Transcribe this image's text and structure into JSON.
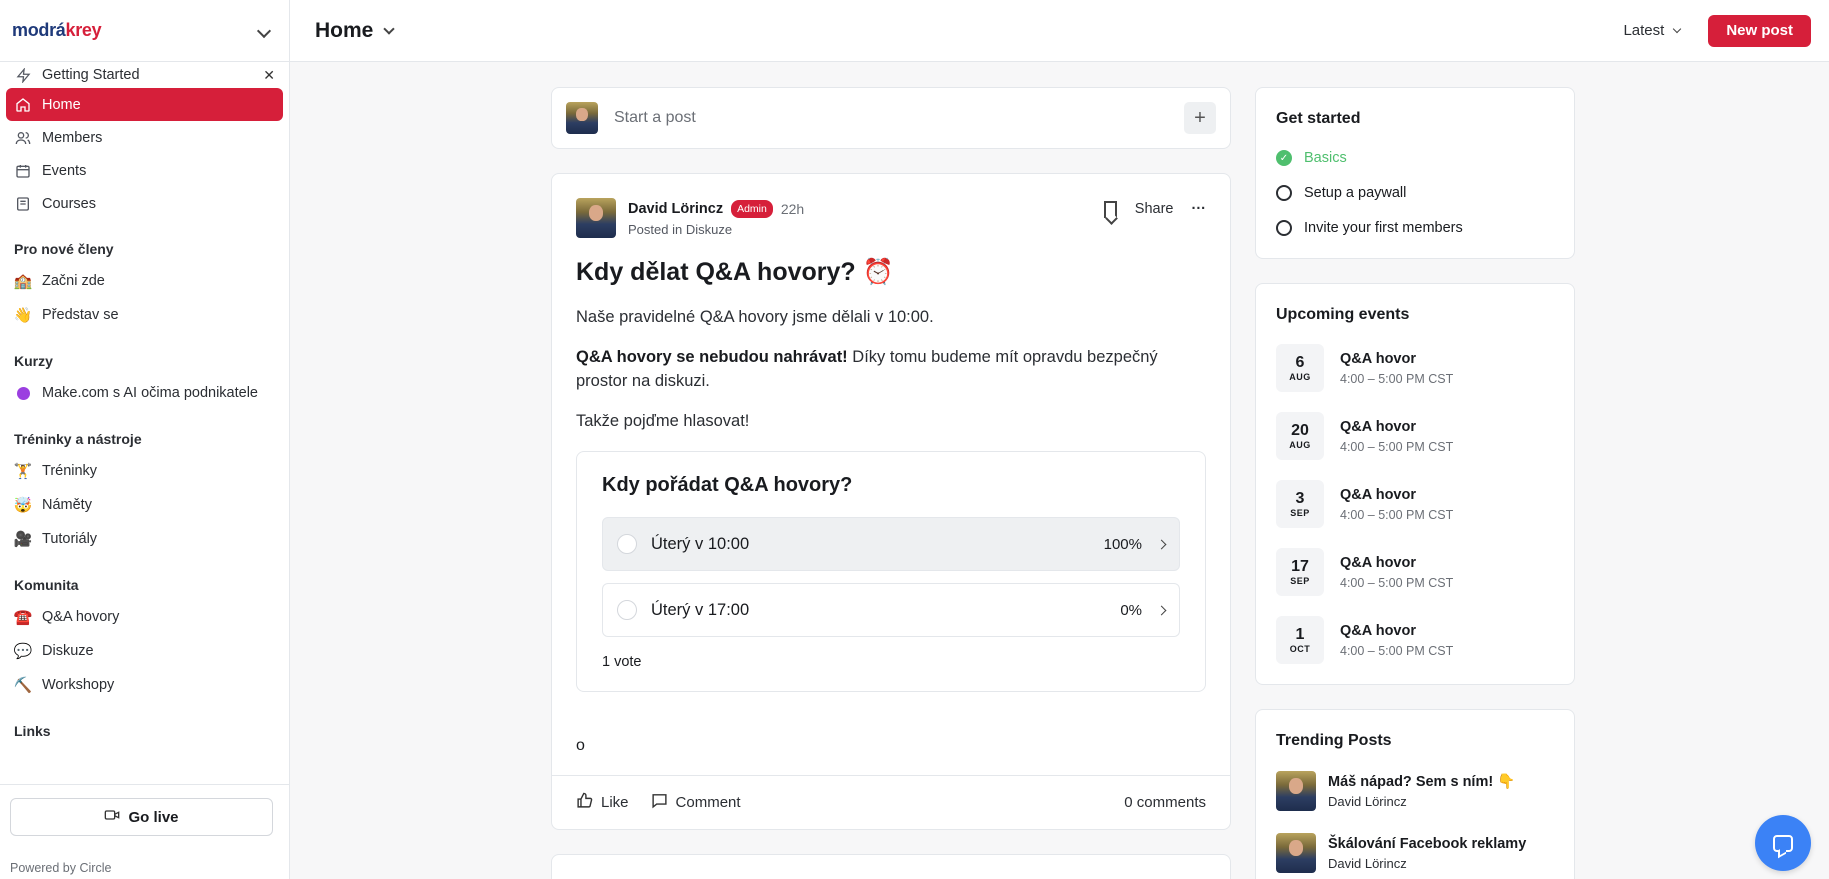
{
  "sidebar": {
    "logo_part1": "modrá",
    "logo_part2": "krey",
    "getting_started": "Getting Started",
    "close_symbol": "✕",
    "nav": [
      {
        "label": "Home",
        "icon": "home-icon"
      },
      {
        "label": "Members",
        "icon": "members-icon"
      },
      {
        "label": "Events",
        "icon": "calendar-icon"
      },
      {
        "label": "Courses",
        "icon": "courses-icon"
      }
    ],
    "sections": [
      {
        "title": "Pro nové členy",
        "items": [
          {
            "emoji": "🏫",
            "label": "Začni zde"
          },
          {
            "emoji": "👋",
            "label": "Představ se"
          }
        ]
      },
      {
        "title": "Kurzy",
        "items": [
          {
            "emoji": "",
            "label": "Make.com s AI očima podnikatele"
          }
        ]
      },
      {
        "title": "Tréninky a nástroje",
        "items": [
          {
            "emoji": "🏋️",
            "label": "Tréninky"
          },
          {
            "emoji": "🤯",
            "label": "Náměty"
          },
          {
            "emoji": "🎥",
            "label": "Tutoriály"
          }
        ]
      },
      {
        "title": "Komunita",
        "items": [
          {
            "emoji": "☎️",
            "label": "Q&A hovory"
          },
          {
            "emoji": "💬",
            "label": "Diskuze"
          },
          {
            "emoji": "⛏️",
            "label": "Workshopy"
          }
        ]
      },
      {
        "title": "Links",
        "items": []
      }
    ],
    "go_live": "Go live",
    "powered_by": "Powered by Circle"
  },
  "topbar": {
    "title": "Home",
    "sort": "Latest",
    "new_post": "New post"
  },
  "composer": {
    "placeholder": "Start a post",
    "plus": "+"
  },
  "post": {
    "author": "David Lörincz",
    "badge": "Admin",
    "time": "22h",
    "posted_in": "Posted in Diskuze",
    "share": "Share",
    "more": "···",
    "title": "Kdy dělat Q&A hovory? ⏰",
    "para1": "Naše pravidelné Q&A hovory jsme dělali v 10:00.",
    "para2_bold": "Q&A hovory se nebudou nahrávat!",
    "para2_rest": " Díky tomu budeme mít opravdu bezpečný prostor na diskuzi.",
    "para3": "Takže pojďme hlasovat!",
    "poll": {
      "question": "Kdy pořádat Q&A hovory?",
      "options": [
        {
          "label": "Úterý v 10:00",
          "pct": "100%"
        },
        {
          "label": "Úterý v 17:00",
          "pct": "0%"
        }
      ],
      "votes": "1 vote"
    },
    "trailing": "o",
    "like": "Like",
    "comment": "Comment",
    "comments_count": "0 comments"
  },
  "get_started": {
    "title": "Get started",
    "items": [
      {
        "label": "Basics",
        "done": true
      },
      {
        "label": "Setup a paywall",
        "done": false
      },
      {
        "label": "Invite your first members",
        "done": false
      }
    ]
  },
  "events": {
    "title": "Upcoming events",
    "items": [
      {
        "day": "6",
        "month": "AUG",
        "name": "Q&A hovor",
        "time": "4:00 – 5:00 PM CST"
      },
      {
        "day": "20",
        "month": "AUG",
        "name": "Q&A hovor",
        "time": "4:00 – 5:00 PM CST"
      },
      {
        "day": "3",
        "month": "SEP",
        "name": "Q&A hovor",
        "time": "4:00 – 5:00 PM CST"
      },
      {
        "day": "17",
        "month": "SEP",
        "name": "Q&A hovor",
        "time": "4:00 – 5:00 PM CST"
      },
      {
        "day": "1",
        "month": "OCT",
        "name": "Q&A hovor",
        "time": "4:00 – 5:00 PM CST"
      }
    ]
  },
  "trending": {
    "title": "Trending Posts",
    "items": [
      {
        "title": "Máš nápad? Sem s ním! 👇",
        "author": "David Lörincz"
      },
      {
        "title": "Škálování Facebook reklamy",
        "author": "David Lörincz"
      }
    ]
  },
  "colors": {
    "brand": "#d61f3a",
    "success": "#4fbf6e",
    "chat": "#3b82f6"
  }
}
